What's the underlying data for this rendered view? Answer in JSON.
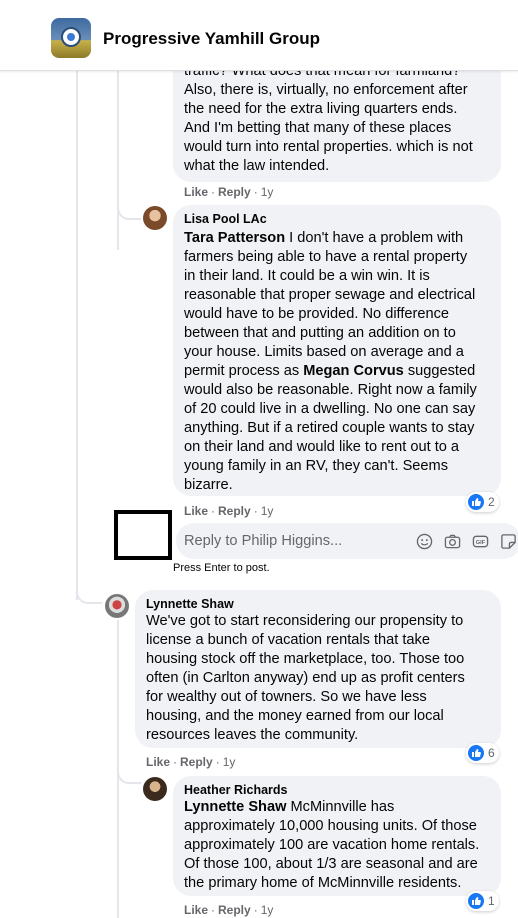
{
  "header": {
    "group_name": "Progressive Yamhill Group"
  },
  "comments": {
    "philip": {
      "lines": [
        "traffic? What does that mean for farmland?",
        "Also, there is, virtually, no enforcement after",
        "the need for the extra living quarters ends.",
        "And I'm betting that many of these places",
        "would turn into rental properties. which is not",
        "what the law intended."
      ],
      "like": "Like",
      "sep": "·",
      "reply": "Reply",
      "time": "1y"
    },
    "lisa": {
      "author": "Lisa Pool LAc",
      "mention1": "Tara Patterson",
      "line1_rest": " I don't have a problem with",
      "line6_start": "permit process as ",
      "mention2": "Megan Corvus",
      "line6_rest": " suggested",
      "lines": [
        "farmers being able to have a rental property",
        "in their land. It could be a win win. It is",
        "reasonable that proper sewage and electrical",
        "would have to be provided. No difference",
        "between that and putting an addition on to",
        "your house. Limits based on average and a"
      ],
      "lines_after": [
        "would also be reasonable. Right now a family",
        "of 20 could live in a dwelling. No one can say",
        "anything. But if a retired couple wants to stay",
        "on their land and would like to rent out to a",
        "young family in an RV, they can't. Seems",
        "bizarre."
      ],
      "like": "Like",
      "sep": "·",
      "reply": "Reply",
      "time": "1y",
      "reaction_count": "2"
    },
    "reply_box": {
      "placeholder": "Reply to Philip Higgins...",
      "hint": "Press Enter to post."
    },
    "lynnette": {
      "author": "Lynnette Shaw",
      "lines": [
        "We've got to start reconsidering our propensity to",
        "license a bunch of vacation rentals that take",
        "housing stock off the marketplace, too. Those too",
        "often (in Carlton anyway) end up as profit centers",
        "for wealthy out of towners. So we have less",
        "housing, and the money earned from our local",
        "resources leaves the community."
      ],
      "like": "Like",
      "sep": "·",
      "reply": "Reply",
      "time": "1y",
      "reaction_count": "6"
    },
    "heather": {
      "author": "Heather Richards",
      "mention": "Lynnette Shaw",
      "line1_rest": " McMinnville has",
      "lines": [
        "approximately 10,000 housing units. Of those",
        "approximately 100 are vacation home rentals.",
        "Of those 100, about 1/3 are seasonal and are",
        "the primary home of McMinnville residents."
      ],
      "like": "Like",
      "sep": "·",
      "reply": "Reply",
      "time": "1y",
      "reaction_count": "1"
    }
  },
  "colors": {
    "bubble": "#f0f2f5",
    "meta_text": "#65676b",
    "like_blue": "#1877f2",
    "thread_line": "#e4e6eb"
  },
  "icons": [
    "like-icon",
    "emoji-icon",
    "camera-icon",
    "gif-icon",
    "sticker-icon"
  ]
}
